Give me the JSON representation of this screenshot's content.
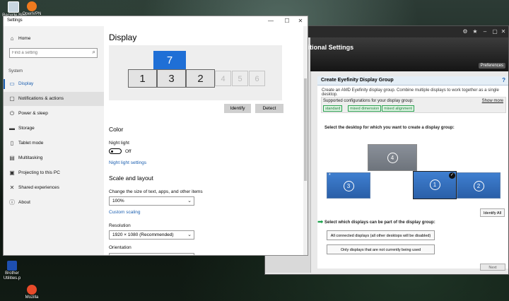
{
  "desktop": {
    "icons": [
      {
        "label": "Recycle Bin",
        "icon": "recycle-bin-icon"
      },
      {
        "label": "OpenVPN",
        "icon": "openvpn-icon"
      },
      {
        "label": "Brother Utilities.p",
        "icon": "brother-utilities-icon"
      },
      {
        "label": "Mozilla",
        "icon": "mozilla-icon"
      }
    ]
  },
  "radeon": {
    "title": "Radeon Additional Settings",
    "preferences_label": "Preferences",
    "eyefinity": {
      "title": "Create Eyefinity Display Group",
      "help_icon": "?",
      "description": "Create an AMD Eyefinity display group. Combine multiple displays to work together as a single desktop.",
      "supported_label": "Supported configurations for your display group:",
      "show_more": "Show more",
      "config_tags": [
        "standard",
        "mixed dimension",
        "mixed alignment"
      ],
      "select_desktop_label": "Select the desktop for which you want to create a display group:",
      "monitors": [
        "4",
        "3",
        "1",
        "2"
      ],
      "star": "*",
      "check": "✓",
      "show_all_label": "Identify All",
      "select_displays_label": "Select which displays can be part of the display group:",
      "options": [
        "All connected displays (all other desktops will be disabled)",
        "Only displays that are not currently being used"
      ],
      "next_label": "Next"
    }
  },
  "settings": {
    "window_title": "Settings",
    "controls": {
      "minimize": "—",
      "maximize": "☐",
      "close": "✕"
    },
    "home_label": "Home",
    "search_placeholder": "Find a setting",
    "system_label": "System",
    "nav": [
      {
        "label": "Display",
        "icon": "display-icon",
        "glyph": "▭"
      },
      {
        "label": "Notifications & actions",
        "icon": "notifications-icon",
        "glyph": "▢"
      },
      {
        "label": "Power & sleep",
        "icon": "power-icon",
        "glyph": "⏻"
      },
      {
        "label": "Storage",
        "icon": "storage-icon",
        "glyph": "▬"
      },
      {
        "label": "Tablet mode",
        "icon": "tablet-mode-icon",
        "glyph": "▯"
      },
      {
        "label": "Multitasking",
        "icon": "multitasking-icon",
        "glyph": "▤"
      },
      {
        "label": "Projecting to this PC",
        "icon": "projecting-icon",
        "glyph": "▣"
      },
      {
        "label": "Shared experiences",
        "icon": "shared-experiences-icon",
        "glyph": "✕"
      },
      {
        "label": "About",
        "icon": "about-icon",
        "glyph": "ⓘ"
      }
    ],
    "page_title": "Display",
    "displays": {
      "top": "7",
      "row": [
        "1",
        "3",
        "2",
        "4",
        "5",
        "6"
      ]
    },
    "identify_label": "Identify",
    "detect_label": "Detect",
    "color_heading": "Color",
    "night_light_label": "Night light",
    "night_light_state": "Off",
    "night_light_settings": "Night light settings",
    "scale_heading": "Scale and layout",
    "scale_label": "Change the size of text, apps, and other items",
    "scale_value": "100%",
    "custom_scaling": "Custom scaling",
    "resolution_label": "Resolution",
    "resolution_value": "1920 × 1080 (Recommended)",
    "orientation_label": "Orientation"
  }
}
